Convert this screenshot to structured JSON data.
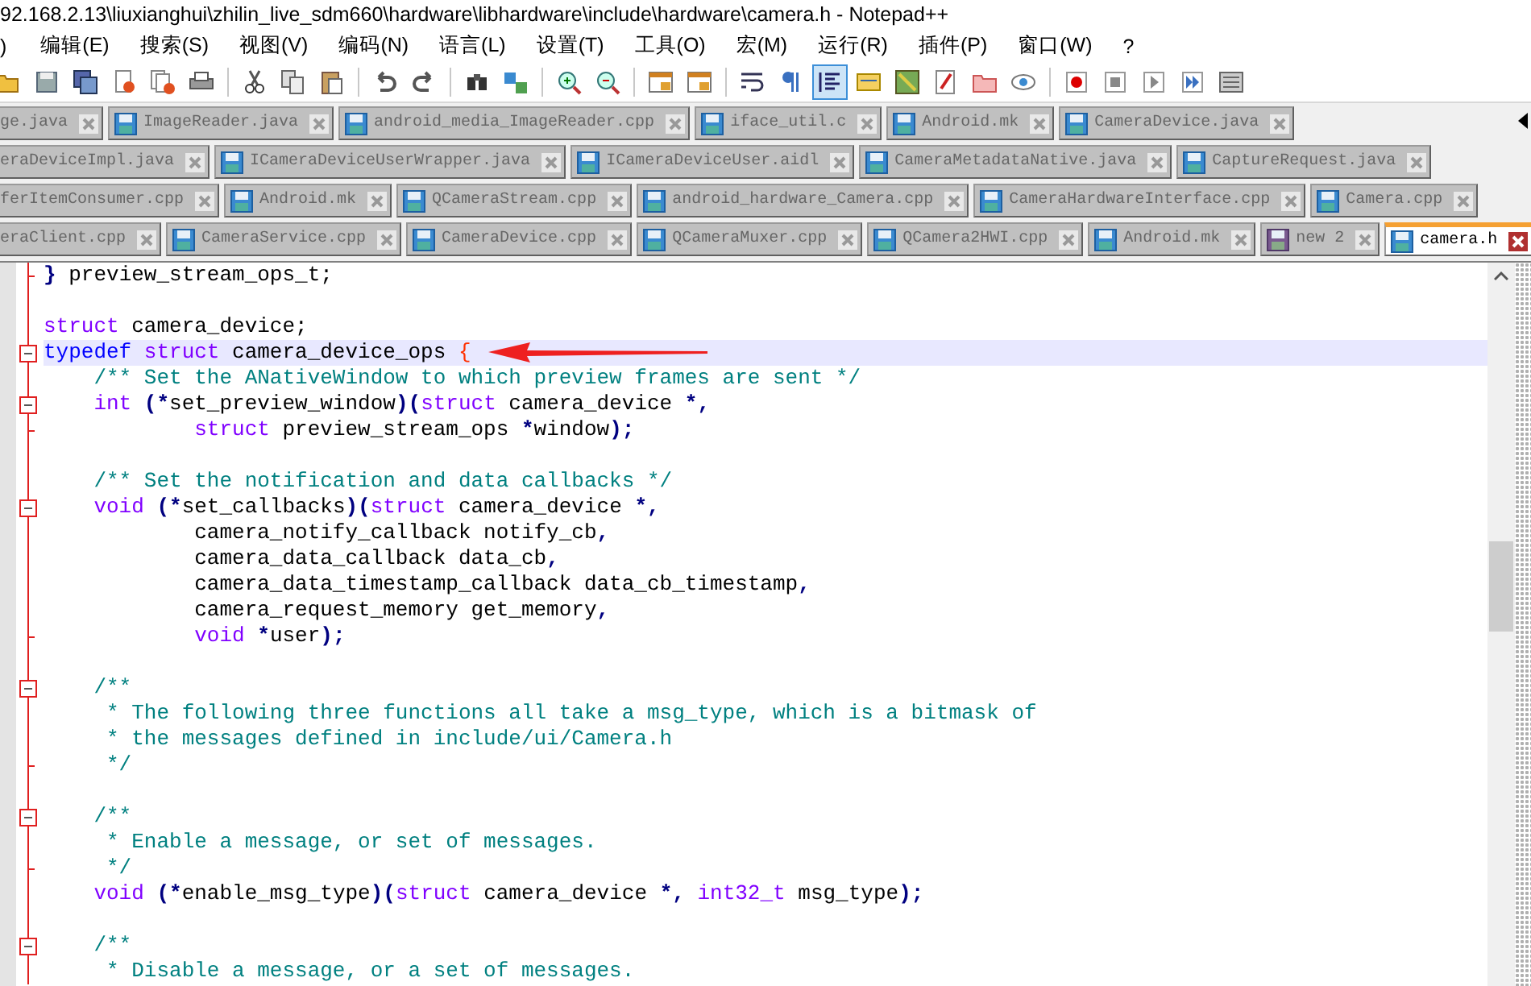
{
  "window": {
    "title": "92.168.2.13\\liuxianghui\\zhilin_live_sdm660\\hardware\\libhardware\\include\\hardware\\camera.h - Notepad++"
  },
  "menu": [
    ")",
    "编辑(E)",
    "搜索(S)",
    "视图(V)",
    "编码(N)",
    "语言(L)",
    "设置(T)",
    "工具(O)",
    "宏(M)",
    "运行(R)",
    "插件(P)",
    "窗口(W)",
    "?"
  ],
  "toolbar": [
    {
      "kind": "open",
      "pressed": false
    },
    {
      "kind": "save",
      "pressed": false
    },
    {
      "kind": "saveall",
      "pressed": false
    },
    {
      "kind": "close",
      "pressed": false
    },
    {
      "kind": "closeall",
      "pressed": false
    },
    {
      "kind": "print",
      "pressed": false
    },
    {
      "kind": "separator"
    },
    {
      "kind": "cut",
      "pressed": false
    },
    {
      "kind": "copy",
      "pressed": false
    },
    {
      "kind": "paste",
      "pressed": false
    },
    {
      "kind": "separator"
    },
    {
      "kind": "undo",
      "pressed": false
    },
    {
      "kind": "redo",
      "pressed": false
    },
    {
      "kind": "separator"
    },
    {
      "kind": "find",
      "pressed": false
    },
    {
      "kind": "replace",
      "pressed": false
    },
    {
      "kind": "separator"
    },
    {
      "kind": "zoomin",
      "pressed": false
    },
    {
      "kind": "zoomout",
      "pressed": false
    },
    {
      "kind": "separator"
    },
    {
      "kind": "syncv",
      "pressed": false
    },
    {
      "kind": "synch",
      "pressed": false
    },
    {
      "kind": "separator"
    },
    {
      "kind": "wrap",
      "pressed": false
    },
    {
      "kind": "pilcrow",
      "pressed": false
    },
    {
      "kind": "indent",
      "pressed": true
    },
    {
      "kind": "udl",
      "pressed": false
    },
    {
      "kind": "docmap",
      "pressed": false
    },
    {
      "kind": "funclist",
      "pressed": false
    },
    {
      "kind": "folder",
      "pressed": false
    },
    {
      "kind": "monitor",
      "pressed": false
    },
    {
      "kind": "separator"
    },
    {
      "kind": "record",
      "pressed": false
    },
    {
      "kind": "stop",
      "pressed": false
    },
    {
      "kind": "play",
      "pressed": false
    },
    {
      "kind": "playmulti",
      "pressed": false
    },
    {
      "kind": "savemacro",
      "pressed": false
    }
  ],
  "tab_rows": [
    [
      {
        "label": "ge.java",
        "selected": false
      },
      {
        "label": "ImageReader.java",
        "kind": "saved",
        "selected": false
      },
      {
        "label": "android_media_ImageReader.cpp",
        "kind": "saved",
        "selected": false
      },
      {
        "label": "iface_util.c",
        "kind": "saved",
        "selected": false
      },
      {
        "label": "Android.mk",
        "kind": "saved",
        "selected": false
      },
      {
        "label": "CameraDevice.java",
        "kind": "saved",
        "selected": false
      }
    ],
    [
      {
        "label": "eraDeviceImpl.java",
        "selected": false
      },
      {
        "label": "ICameraDeviceUserWrapper.java",
        "kind": "saved",
        "selected": false
      },
      {
        "label": "ICameraDeviceUser.aidl",
        "kind": "saved",
        "selected": false
      },
      {
        "label": "CameraMetadataNative.java",
        "kind": "saved",
        "selected": false
      },
      {
        "label": "CaptureRequest.java",
        "kind": "saved",
        "selected": false
      }
    ],
    [
      {
        "label": "ferItemConsumer.cpp",
        "selected": false
      },
      {
        "label": "Android.mk",
        "kind": "saved",
        "selected": false
      },
      {
        "label": "QCameraStream.cpp",
        "kind": "saved",
        "selected": false
      },
      {
        "label": "android_hardware_Camera.cpp",
        "kind": "saved",
        "selected": false
      },
      {
        "label": "CameraHardwareInterface.cpp",
        "kind": "saved",
        "selected": false
      },
      {
        "label": "Camera.cpp",
        "kind": "saved",
        "selected": false
      }
    ],
    [
      {
        "label": "eraClient.cpp",
        "selected": false
      },
      {
        "label": "CameraService.cpp",
        "kind": "saved",
        "selected": false
      },
      {
        "label": "CameraDevice.cpp",
        "kind": "saved",
        "selected": false
      },
      {
        "label": "QCameraMuxer.cpp",
        "kind": "saved",
        "selected": false
      },
      {
        "label": "QCamera2HWI.cpp",
        "kind": "saved",
        "selected": false
      },
      {
        "label": "Android.mk",
        "kind": "saved",
        "selected": false
      },
      {
        "label": "new 2",
        "kind": "new",
        "selected": false
      },
      {
        "label": "camera.h",
        "kind": "saved",
        "selected": true
      }
    ]
  ],
  "editor": {
    "lines": [
      {
        "kind": "fold_end",
        "current": false,
        "tokens": [
          {
            "kind": "operator",
            "text": "}"
          },
          {
            "kind": "text",
            "text": " preview_stream_ops_t;"
          }
        ]
      },
      {
        "kind": "plain",
        "current": false
      },
      {
        "kind": "plain",
        "current": false,
        "tokens": [
          {
            "kind": "type",
            "text": "struct"
          },
          {
            "kind": "text",
            "text": " camera_device;"
          }
        ]
      },
      {
        "kind": "fold_start",
        "current": true,
        "tokens": [
          {
            "kind": "keyword",
            "text": "typedef"
          },
          {
            "kind": "type",
            "text": " struct"
          },
          {
            "kind": "text",
            "text": " camera_device_ops "
          },
          {
            "kind": "brace",
            "text": "{"
          }
        ]
      },
      {
        "kind": "plain",
        "current": false,
        "tokens": [
          {
            "kind": "comment",
            "text": "    /** Set the ANativeWindow to which preview frames are sent */"
          }
        ]
      },
      {
        "kind": "fold_start",
        "current": false,
        "tokens": [
          {
            "kind": "type",
            "text": "    int"
          },
          {
            "kind": "operator",
            "text": " (*"
          },
          {
            "kind": "text",
            "text": "set_preview_window"
          },
          {
            "kind": "operator",
            "text": ")("
          },
          {
            "kind": "type",
            "text": "struct"
          },
          {
            "kind": "text",
            "text": " camera_device "
          },
          {
            "kind": "operator",
            "text": "*,"
          }
        ]
      },
      {
        "kind": "fold_end",
        "current": false,
        "tokens": [
          {
            "kind": "type",
            "text": "            struct"
          },
          {
            "kind": "text",
            "text": " preview_stream_ops "
          },
          {
            "kind": "operator",
            "text": "*"
          },
          {
            "kind": "text",
            "text": "window"
          },
          {
            "kind": "operator",
            "text": ");"
          }
        ]
      },
      {
        "kind": "plain",
        "current": false
      },
      {
        "kind": "plain",
        "current": false,
        "tokens": [
          {
            "kind": "comment",
            "text": "    /** Set the notification and data callbacks */"
          }
        ]
      },
      {
        "kind": "fold_start",
        "current": false,
        "tokens": [
          {
            "kind": "type",
            "text": "    void"
          },
          {
            "kind": "operator",
            "text": " (*"
          },
          {
            "kind": "text",
            "text": "set_callbacks"
          },
          {
            "kind": "operator",
            "text": ")("
          },
          {
            "kind": "type",
            "text": "struct"
          },
          {
            "kind": "text",
            "text": " camera_device "
          },
          {
            "kind": "operator",
            "text": "*,"
          }
        ]
      },
      {
        "kind": "plain",
        "current": false,
        "tokens": [
          {
            "kind": "text",
            "text": "            camera_notify_callback notify_cb"
          },
          {
            "kind": "operator",
            "text": ","
          }
        ]
      },
      {
        "kind": "plain",
        "current": false,
        "tokens": [
          {
            "kind": "text",
            "text": "            camera_data_callback data_cb"
          },
          {
            "kind": "operator",
            "text": ","
          }
        ]
      },
      {
        "kind": "plain",
        "current": false,
        "tokens": [
          {
            "kind": "text",
            "text": "            camera_data_timestamp_callback data_cb_timestamp"
          },
          {
            "kind": "operator",
            "text": ","
          }
        ]
      },
      {
        "kind": "plain",
        "current": false,
        "tokens": [
          {
            "kind": "text",
            "text": "            camera_request_memory get_memory"
          },
          {
            "kind": "operator",
            "text": ","
          }
        ]
      },
      {
        "kind": "fold_end",
        "current": false,
        "tokens": [
          {
            "kind": "type",
            "text": "            void"
          },
          {
            "kind": "operator",
            "text": " *"
          },
          {
            "kind": "text",
            "text": "user"
          },
          {
            "kind": "operator",
            "text": ");"
          }
        ]
      },
      {
        "kind": "plain",
        "current": false
      },
      {
        "kind": "fold_start",
        "current": false,
        "tokens": [
          {
            "kind": "comment",
            "text": "    /**"
          }
        ]
      },
      {
        "kind": "plain",
        "current": false,
        "tokens": [
          {
            "kind": "comment",
            "text": "     * The following three functions all take a msg_type, which is a bitmask of"
          }
        ]
      },
      {
        "kind": "plain",
        "current": false,
        "tokens": [
          {
            "kind": "comment",
            "text": "     * the messages defined in include/ui/Camera.h"
          }
        ]
      },
      {
        "kind": "fold_end",
        "current": false,
        "tokens": [
          {
            "kind": "comment",
            "text": "     */"
          }
        ]
      },
      {
        "kind": "plain",
        "current": false
      },
      {
        "kind": "fold_start",
        "current": false,
        "tokens": [
          {
            "kind": "comment",
            "text": "    /**"
          }
        ]
      },
      {
        "kind": "plain",
        "current": false,
        "tokens": [
          {
            "kind": "comment",
            "text": "     * Enable a message, or set of messages."
          }
        ]
      },
      {
        "kind": "fold_end",
        "current": false,
        "tokens": [
          {
            "kind": "comment",
            "text": "     */"
          }
        ]
      },
      {
        "kind": "plain",
        "current": false,
        "tokens": [
          {
            "kind": "type",
            "text": "    void"
          },
          {
            "kind": "operator",
            "text": " (*"
          },
          {
            "kind": "text",
            "text": "enable_msg_type"
          },
          {
            "kind": "operator",
            "text": ")("
          },
          {
            "kind": "type",
            "text": "struct"
          },
          {
            "kind": "text",
            "text": " camera_device "
          },
          {
            "kind": "operator",
            "text": "*,"
          },
          {
            "kind": "type",
            "text": " int32_t"
          },
          {
            "kind": "text",
            "text": " msg_type"
          },
          {
            "kind": "operator",
            "text": ");"
          }
        ]
      },
      {
        "kind": "plain",
        "current": false
      },
      {
        "kind": "fold_start",
        "current": false,
        "tokens": [
          {
            "kind": "comment",
            "text": "    /**"
          }
        ]
      },
      {
        "kind": "plain",
        "current": false,
        "tokens": [
          {
            "kind": "comment",
            "text": "     * Disable a message, or a set of messages."
          }
        ]
      }
    ]
  }
}
